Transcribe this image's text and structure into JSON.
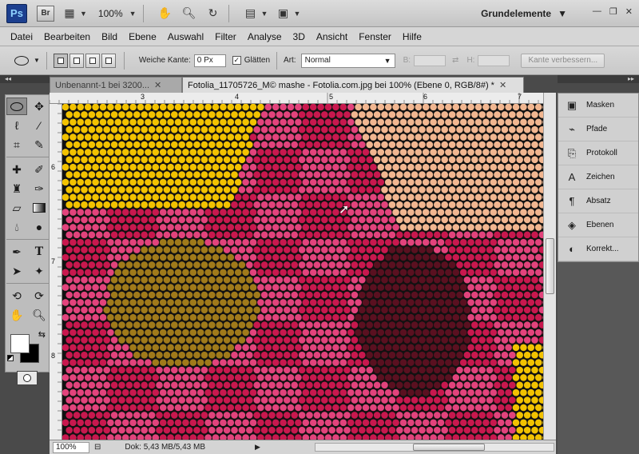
{
  "appbar": {
    "ps_logo": "Ps",
    "br_logo": "Br",
    "zoom": "100%",
    "workspace": "Grundelemente"
  },
  "menu": [
    "Datei",
    "Bearbeiten",
    "Bild",
    "Ebene",
    "Auswahl",
    "Filter",
    "Analyse",
    "3D",
    "Ansicht",
    "Fenster",
    "Hilfe"
  ],
  "options": {
    "feather_label": "Weiche Kante:",
    "feather_value": "0 Px",
    "antialias_label": "Glätten",
    "antialias_checked": true,
    "style_label": "Art:",
    "style_value": "Normal",
    "width_label": "B:",
    "height_label": "H:",
    "refine_label": "Kante verbessern..."
  },
  "tabs": [
    {
      "label": "Unbenannt-1 bei 3200...",
      "active": false
    },
    {
      "label": "Fotolia_11705726_M© mashe - Fotolia.com.jpg bei 100% (Ebene 0, RGB/8#) *",
      "active": true
    }
  ],
  "ruler_top": [
    "3",
    "4",
    "5",
    "6",
    "7"
  ],
  "ruler_left": [
    "6",
    "7",
    "8"
  ],
  "status": {
    "zoom": "100%",
    "doc": "Dok: 5,43 MB/5,43 MB"
  },
  "panels": [
    {
      "label": "Masken",
      "icon": "masks-icon"
    },
    {
      "label": "Pfade",
      "icon": "paths-icon"
    },
    {
      "label": "Protokoll",
      "icon": "history-icon"
    },
    {
      "label": "Zeichen",
      "icon": "character-icon"
    },
    {
      "label": "Absatz",
      "icon": "paragraph-icon"
    },
    {
      "label": "Ebenen",
      "icon": "layers-icon"
    },
    {
      "label": "Korrekt...",
      "icon": "adjustments-icon"
    }
  ],
  "colors": {
    "foreground": "#ffffff",
    "background": "#000000",
    "dot_yellow": "#f2c200",
    "dot_crimson": "#c8184e",
    "dot_pink": "#e2437c",
    "dot_peach": "#f1b690",
    "dot_olive": "#a07a1a"
  }
}
